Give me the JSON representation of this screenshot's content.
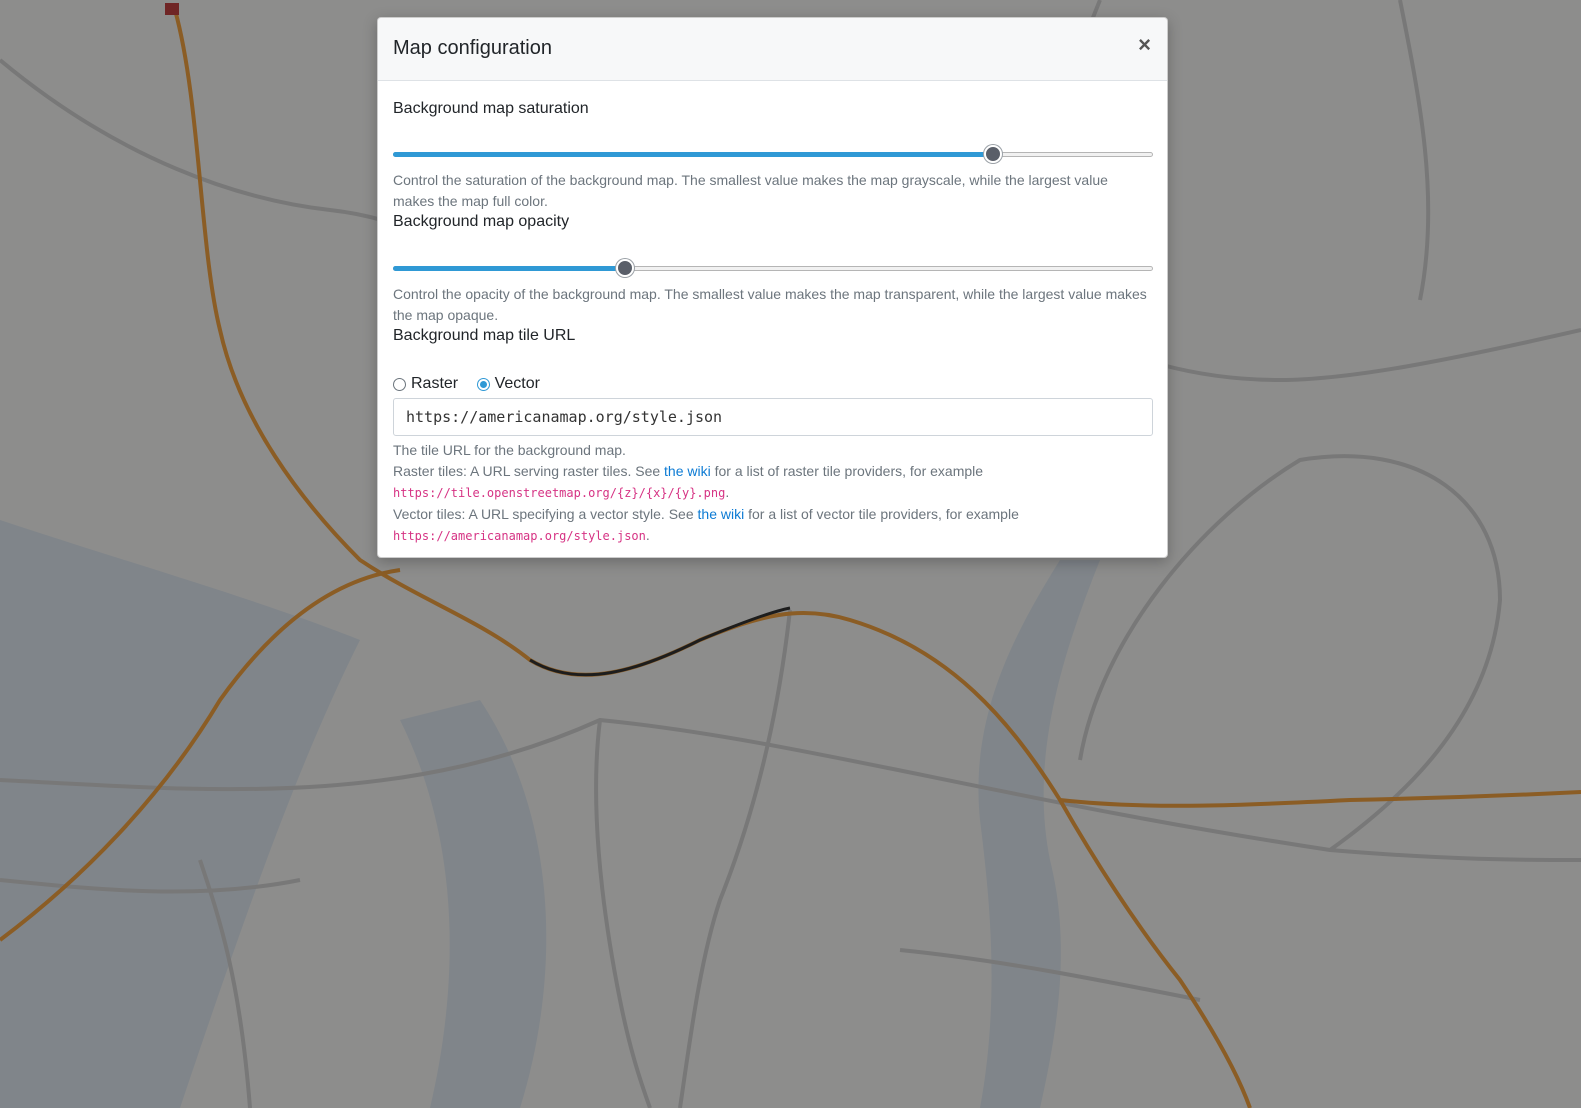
{
  "dialog": {
    "title": "Map configuration",
    "close_label": "×"
  },
  "saturation": {
    "label": "Background map saturation",
    "value_fraction": 0.79,
    "help": "Control the saturation of the background map. The smallest value makes the map grayscale, while the largest value makes the map full color."
  },
  "opacity": {
    "label": "Background map opacity",
    "value_fraction": 0.305,
    "help": "Control the opacity of the background map. The smallest value makes the map transparent, while the largest value makes the map opaque."
  },
  "tile_url": {
    "label": "Background map tile URL",
    "options": [
      "Raster",
      "Vector"
    ],
    "selected": "Vector",
    "value": "https://americanamap.org/style.json",
    "help": {
      "intro": "The tile URL for the background map.",
      "raster_prefix": "Raster tiles: A URL serving raster tiles. See ",
      "raster_link": "the wiki",
      "raster_middle": " for a list of raster tile providers, for example ",
      "raster_example": "https://tile.openstreetmap.org/{z}/{x}/{y}.png",
      "vector_prefix": "Vector tiles: A URL specifying a vector style. See ",
      "vector_link": "the wiki",
      "vector_middle": " for a list of vector tile providers, for example ",
      "vector_example": "https://americanamap.org/style.json",
      "suffix": "."
    }
  },
  "colors": {
    "accent": "#2f99d5",
    "rail_orange": "#f0a040",
    "map_base": "#f3f3f1"
  }
}
